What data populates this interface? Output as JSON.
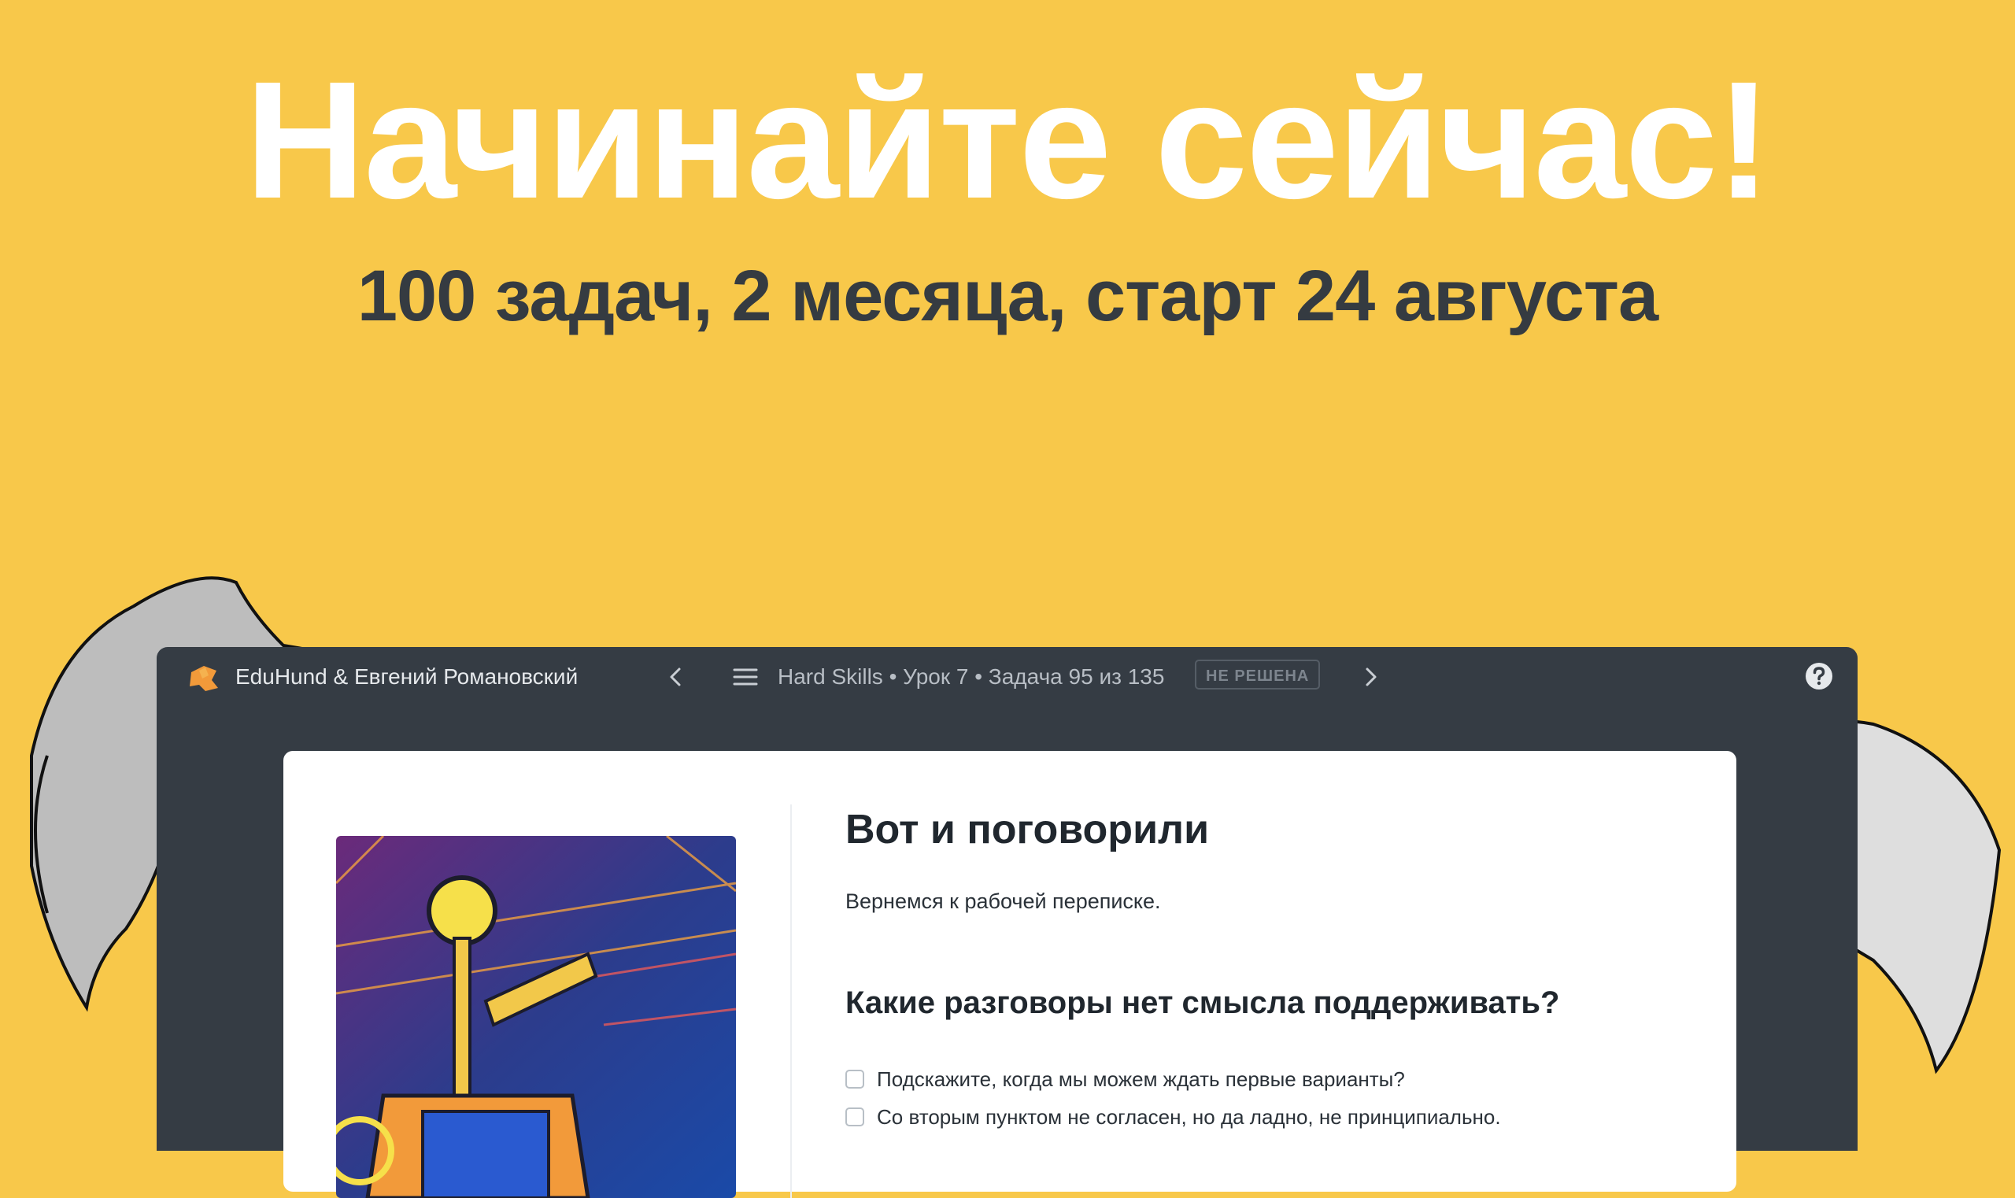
{
  "hero": {
    "headline": "Начинайте сейчас!",
    "subheadline": "100 задач, 2 месяца, старт 24 августа"
  },
  "app": {
    "brand": "EduHund & Евгений Романовский",
    "course_path": "Hard Skills • Урок 7 • Задача 95 из 135",
    "status": "НЕ РЕШЕНА"
  },
  "lesson": {
    "title": "Вот и поговорили",
    "intro": "Вернемся к рабочей переписке.",
    "question": "Какие разговоры нет смысла поддерживать?",
    "options": [
      "Подскажите, когда мы можем ждать первые варианты?",
      "Со вторым пунктом не согласен, но да ладно, не принципиально."
    ]
  },
  "colors": {
    "background": "#f8c84a",
    "app_frame": "#353c44",
    "card": "#ffffff"
  },
  "icons": [
    "logo-icon",
    "chevron-left-icon",
    "menu-icon",
    "chevron-right-icon",
    "help-icon",
    "checkbox-icon"
  ]
}
